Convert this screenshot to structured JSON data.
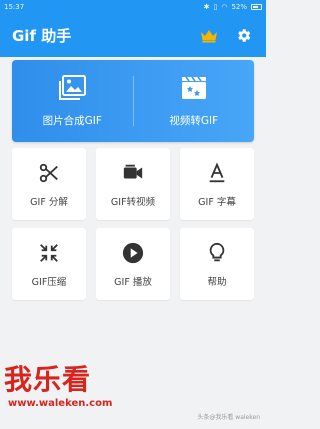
{
  "status_bar": {
    "time": "15:37",
    "battery": "52%",
    "icons": [
      "bluetooth-icon",
      "vibrate-icon",
      "wifi-icon",
      "battery-icon"
    ]
  },
  "app_bar": {
    "title": "Gif 助手",
    "icons": [
      "crown-icon",
      "gear-icon"
    ],
    "accent_color": "#2196f3",
    "crown_color": "#f7b500"
  },
  "banner": {
    "left_label": "图片合成GIF",
    "right_label": "视频转GIF",
    "icons": [
      "image-icon",
      "video-clapper-icon"
    ]
  },
  "tiles": [
    {
      "label": "GIF 分解",
      "icon": "scissors-icon"
    },
    {
      "label": "GIF转视频",
      "icon": "video-camera-icon"
    },
    {
      "label": "GIF 字幕",
      "icon": "text-icon"
    },
    {
      "label": "GIF压缩",
      "icon": "compress-icon"
    },
    {
      "label": "GIF 播放",
      "icon": "play-icon"
    },
    {
      "label": "帮助",
      "icon": "lightbulb-icon"
    }
  ],
  "watermark": {
    "logo_text": "我乐看",
    "url": "www.waleken.com",
    "credit": "头条@我乐看 waleken"
  }
}
